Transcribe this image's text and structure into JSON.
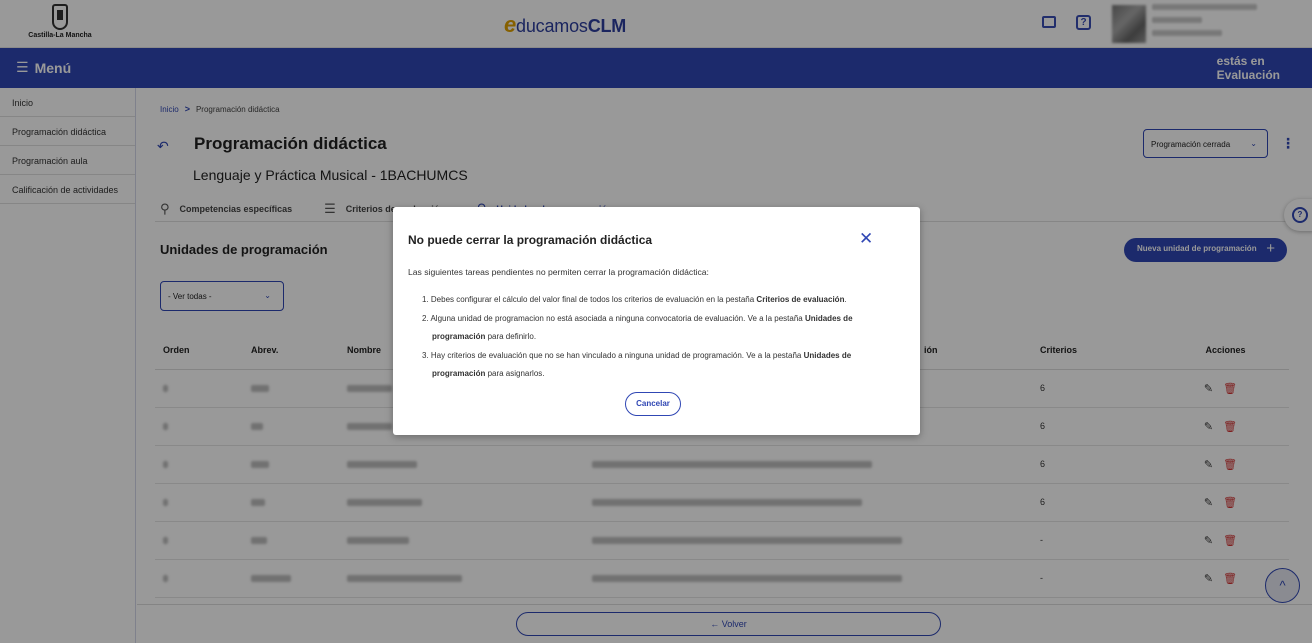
{
  "header": {
    "logo_caption": "Castilla-La Mancha",
    "brand_e": "e",
    "brand_ducamos": "ducamos",
    "brand_clm": "CLM"
  },
  "bluebar": {
    "menu_label": "Menú",
    "location_line1": "estás en",
    "location_line2": "Evaluación"
  },
  "sidebar": {
    "items": [
      {
        "label": "Inicio"
      },
      {
        "label": "Programación didáctica"
      },
      {
        "label": "Programación aula"
      },
      {
        "label": "Calificación de actividades"
      }
    ]
  },
  "breadcrumb": {
    "home": "Inicio",
    "current": "Programación didáctica"
  },
  "page": {
    "title": "Programación didáctica",
    "subtitle": "Lenguaje y Práctica Musical - 1BACHUMCS",
    "status": "Programación cerrada"
  },
  "tabs": [
    {
      "label": "Competencias específicas"
    },
    {
      "label": "Criterios de evaluación"
    },
    {
      "label": "Unidades de programación"
    }
  ],
  "units": {
    "title": "Unidades de programación",
    "new_button": "Nueva unidad de programación",
    "filter": "- Ver todas -",
    "columns": {
      "orden": "Orden",
      "abrev": "Abrev.",
      "nombre": "Nombre",
      "evaluacion_suffix": "ión",
      "criterios": "Criterios",
      "acciones": "Acciones"
    },
    "rows": [
      {
        "criterios": "6"
      },
      {
        "criterios": "6"
      },
      {
        "criterios": "6"
      },
      {
        "criterios": "6"
      },
      {
        "criterios": "-"
      },
      {
        "criterios": "-"
      }
    ]
  },
  "footer": {
    "back_button": "Volver"
  },
  "modal": {
    "title": "No puede cerrar la programación didáctica",
    "intro": "Las siguientes tareas pendientes no permiten cerrar la programación didáctica:",
    "item1_text": "1. Debes configurar el cálculo del valor final de todos los criterios de evaluación en la pestaña ",
    "item1_bold": "Criterios de evaluación",
    "item1_end": ".",
    "item2_text": "2. Alguna unidad de programacion no está asociada a ninguna convocatoria de evaluación. Ve a la pestaña ",
    "item2_bold1": "Unidades de",
    "item2_bold2": "programación",
    "item2_end": " para definirlo.",
    "item3_text": "3. Hay criterios de evaluación que no se han vinculado a ninguna unidad de programación. Ve a la pestaña ",
    "item3_bold1": "Unidades de",
    "item3_bold2": "programación",
    "item3_end": " para asignarlos.",
    "cancel": "Cancelar"
  },
  "colors": {
    "primary": "#3047b4",
    "delete": "#d23232",
    "brand_accent": "#e0a100"
  }
}
